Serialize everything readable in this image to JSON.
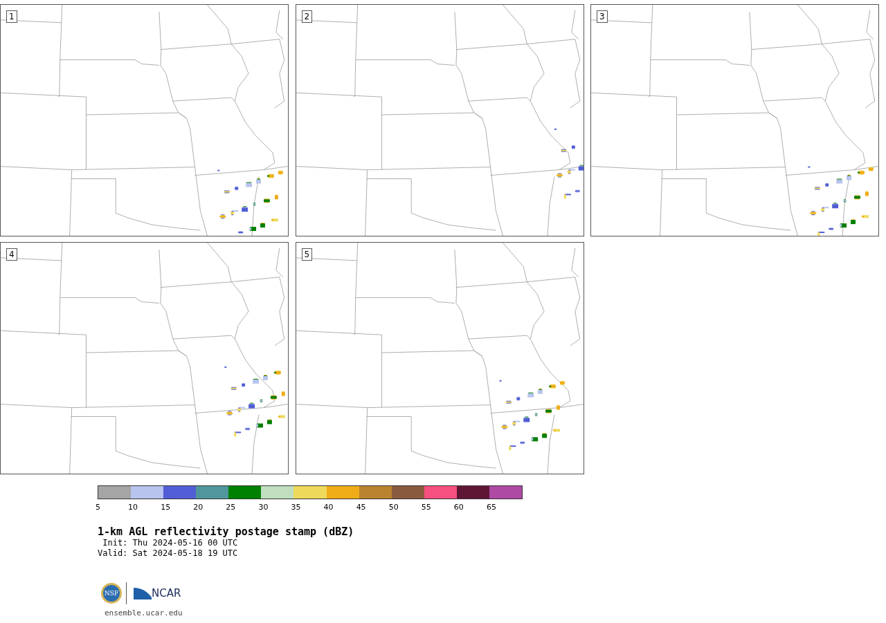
{
  "panels": [
    {
      "label": "1"
    },
    {
      "label": "2"
    },
    {
      "label": "3"
    },
    {
      "label": "4"
    },
    {
      "label": "5"
    }
  ],
  "colorbar": {
    "bins": [
      {
        "tick": "5",
        "color": "#a5a5a5"
      },
      {
        "tick": "10",
        "color": "#b8c4ee"
      },
      {
        "tick": "15",
        "color": "#525ed6"
      },
      {
        "tick": "20",
        "color": "#50969c"
      },
      {
        "tick": "25",
        "color": "#008000"
      },
      {
        "tick": "30",
        "color": "#bfdfbf"
      },
      {
        "tick": "35",
        "color": "#efd95b"
      },
      {
        "tick": "40",
        "color": "#f0ac17"
      },
      {
        "tick": "45",
        "color": "#ba832f"
      },
      {
        "tick": "50",
        "color": "#8a5a3f"
      },
      {
        "tick": "55",
        "color": "#f5507f"
      },
      {
        "tick": "60",
        "color": "#5f1634"
      },
      {
        "tick": "65",
        "color": "#ae4aa4"
      }
    ]
  },
  "title": "1-km AGL reflectivity postage stamp (dBZ)",
  "init": " Init: Thu 2024-05-16 00 UTC",
  "valid": "Valid: Sat 2024-05-18 19 UTC",
  "logos": {
    "nsf": "NSF",
    "ncar": "NCAR"
  },
  "url": "ensemble.ucar.edu"
}
